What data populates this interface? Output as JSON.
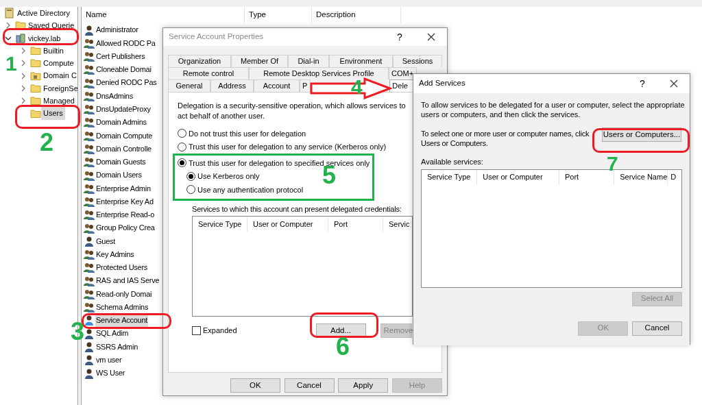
{
  "tree": [
    {
      "label": "Active Directory",
      "kind": "snapin",
      "selected": false,
      "children": [
        {
          "label": "Saved Querie",
          "kind": "folder",
          "expanded": false,
          "selected": false
        },
        {
          "label": "vickey.lab",
          "kind": "domain",
          "expanded": true,
          "selected": false,
          "children": [
            {
              "label": "Builtin",
              "kind": "folder",
              "expanded": false,
              "selected": false
            },
            {
              "label": "Compute",
              "kind": "folder",
              "expanded": false,
              "selected": false
            },
            {
              "label": "Domain C",
              "kind": "special-folder",
              "expanded": false,
              "selected": false
            },
            {
              "label": "ForeignSe",
              "kind": "folder",
              "expanded": false,
              "selected": false
            },
            {
              "label": "Managed",
              "kind": "folder",
              "expanded": false,
              "selected": false
            },
            {
              "label": "Users",
              "kind": "folder",
              "selected": true
            }
          ]
        }
      ]
    }
  ],
  "list": {
    "columns": [
      "Name",
      "Type",
      "Description"
    ],
    "rows": [
      {
        "name": "Administrator",
        "kind": "user",
        "selected": false
      },
      {
        "name": "Allowed RODC Pa",
        "kind": "group",
        "selected": false
      },
      {
        "name": "Cert Publishers",
        "kind": "group",
        "selected": false
      },
      {
        "name": "Cloneable Domai",
        "kind": "group",
        "selected": false
      },
      {
        "name": "Denied RODC Pas",
        "kind": "group",
        "selected": false
      },
      {
        "name": "DnsAdmins",
        "kind": "group",
        "selected": false
      },
      {
        "name": "DnsUpdateProxy",
        "kind": "group",
        "selected": false
      },
      {
        "name": "Domain Admins",
        "kind": "group",
        "selected": false
      },
      {
        "name": "Domain Compute",
        "kind": "group",
        "selected": false
      },
      {
        "name": "Domain Controlle",
        "kind": "group",
        "selected": false
      },
      {
        "name": "Domain Guests",
        "kind": "group",
        "selected": false
      },
      {
        "name": "Domain Users",
        "kind": "group",
        "selected": false
      },
      {
        "name": "Enterprise Admin",
        "kind": "group",
        "selected": false
      },
      {
        "name": "Enterprise Key Ad",
        "kind": "group",
        "selected": false
      },
      {
        "name": "Enterprise Read-o",
        "kind": "group",
        "selected": false
      },
      {
        "name": "Group Policy Crea",
        "kind": "group",
        "selected": false
      },
      {
        "name": "Guest",
        "kind": "user",
        "selected": false
      },
      {
        "name": "Key Admins",
        "kind": "group",
        "selected": false
      },
      {
        "name": "Protected Users",
        "kind": "group",
        "selected": false
      },
      {
        "name": "RAS and IAS Serve",
        "kind": "group",
        "selected": false
      },
      {
        "name": "Read-only Domai",
        "kind": "group",
        "selected": false
      },
      {
        "name": "Schema Admins",
        "kind": "group",
        "selected": false
      },
      {
        "name": "Service Account",
        "kind": "user",
        "selected": true
      },
      {
        "name": "SQL Adim",
        "kind": "user",
        "selected": false
      },
      {
        "name": "SSRS Admin",
        "kind": "user",
        "selected": false
      },
      {
        "name": "vm user",
        "kind": "user",
        "selected": false
      },
      {
        "name": "WS User",
        "kind": "user",
        "selected": false
      }
    ]
  },
  "properties": {
    "title": "Service Account Properties",
    "help_glyph": "?",
    "tab_rows": [
      [
        {
          "label": "Organization",
          "selected": false
        },
        {
          "label": "Member Of",
          "selected": false
        },
        {
          "label": "Dial-in",
          "selected": false
        },
        {
          "label": "Environment",
          "selected": false
        },
        {
          "label": "Sessions",
          "selected": false
        }
      ],
      [
        {
          "label": "Remote control",
          "selected": false
        },
        {
          "label": "Remote Desktop Services Profile",
          "selected": false
        },
        {
          "label": "COM+",
          "selected": false
        }
      ],
      [
        {
          "label": "General",
          "selected": false
        },
        {
          "label": "Address",
          "selected": false
        },
        {
          "label": "Account",
          "selected": false
        },
        {
          "label": "P",
          "selected": false
        },
        {
          "label": "Dele",
          "selected": true
        }
      ]
    ],
    "intro": "Delegation is a security-sensitive operation, which allows services to act behalf of another user.",
    "options": [
      {
        "label": "Do not trust this user for delegation",
        "selected": false
      },
      {
        "label": "Trust this user for delegation to any service (Kerberos only)",
        "selected": false
      },
      {
        "label": "Trust this user for delegation to specified services only",
        "selected": true,
        "children": [
          {
            "label": "Use Kerberos only",
            "selected": true
          },
          {
            "label": "Use any authentication protocol",
            "selected": false
          }
        ]
      }
    ],
    "services_label": "Services to which this account can present delegated credentials:",
    "services_columns": [
      "Service Type",
      "User or Computer",
      "Port",
      "Servic"
    ],
    "expanded": {
      "label": "Expanded",
      "checked": false
    },
    "add_button": {
      "label": "Add...",
      "disabled": false
    },
    "remove_button": {
      "label": "Remove",
      "disabled": true
    },
    "buttons": [
      {
        "label": "OK",
        "disabled": false
      },
      {
        "label": "Cancel",
        "disabled": false
      },
      {
        "label": "Apply",
        "disabled": false
      },
      {
        "label": "Help",
        "disabled": true
      }
    ]
  },
  "add_services": {
    "title": "Add Services",
    "help_glyph": "?",
    "intro": "To allow services to be delegated for a user or computer, select the appropriate users or computers, and then click the services.",
    "select_text": "To select one or more user or computer names, click\nUsers or Computers.",
    "users_button": {
      "label": "Users or Computers...",
      "disabled": false
    },
    "available_label": "Available services:",
    "columns": [
      "Service Type",
      "User or Computer",
      "Port",
      "Service Name",
      "D"
    ],
    "select_all": {
      "label": "Select All",
      "disabled": true
    },
    "buttons": [
      {
        "label": "OK",
        "disabled": true
      },
      {
        "label": "Cancel",
        "disabled": false
      }
    ]
  },
  "annotations": [
    {
      "label": "1"
    },
    {
      "label": "2"
    },
    {
      "label": "3"
    },
    {
      "label": "4"
    },
    {
      "label": "5"
    },
    {
      "label": "6"
    },
    {
      "label": "7"
    }
  ]
}
